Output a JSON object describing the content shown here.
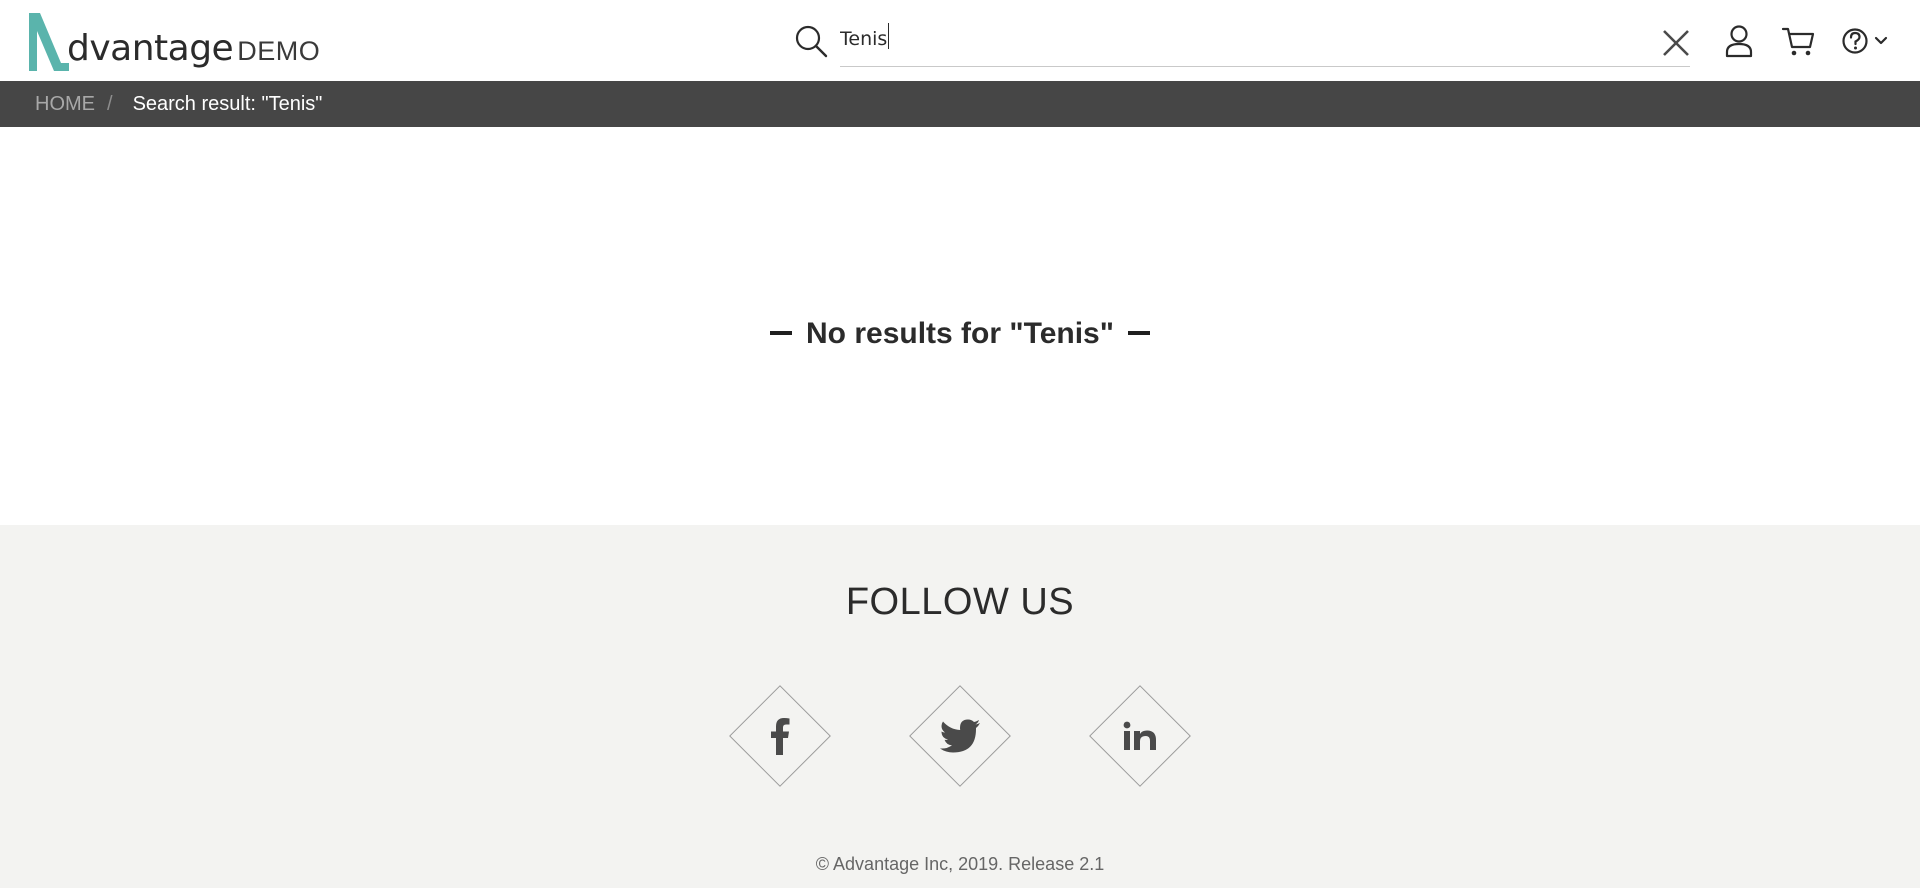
{
  "header": {
    "logo": {
      "word": "dvantage",
      "suffix": "DEMO",
      "accent_color": "#5ab4ac"
    },
    "search": {
      "value": "Tenis",
      "placeholder": ""
    },
    "icons": {
      "search": "search-icon",
      "clear": "close-icon",
      "user": "user-icon",
      "cart": "cart-icon",
      "help": "help-icon",
      "help_menu": "chevron-down-icon"
    }
  },
  "breadcrumb": {
    "home": "HOME",
    "separator": "/",
    "current": "Search result: \"Tenis\""
  },
  "main": {
    "no_results": "No results for \"Tenis\""
  },
  "footer": {
    "follow_title": "FOLLOW US",
    "social": [
      {
        "name": "facebook-icon"
      },
      {
        "name": "twitter-icon"
      },
      {
        "name": "linkedin-icon"
      }
    ],
    "copyright": "© Advantage Inc, 2019. Release 2.1"
  },
  "colors": {
    "breadcrumb_bg": "#464646",
    "footer_bg": "#f3f3f1",
    "brand": "#5ab4ac"
  }
}
